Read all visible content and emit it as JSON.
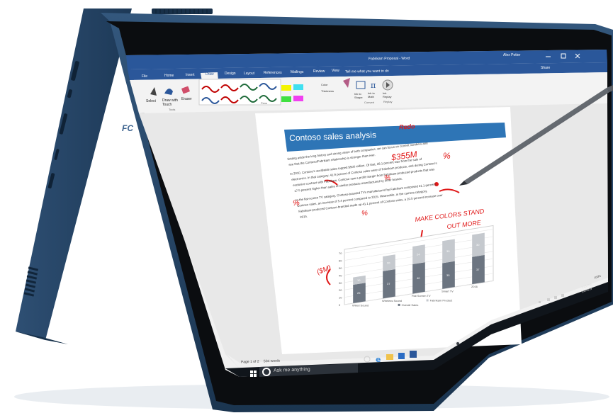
{
  "window": {
    "title": "Fabrikam Proposal - Word",
    "user": "Alex Potter"
  },
  "ribbon": {
    "tabs": [
      "File",
      "Home",
      "Insert",
      "Draw",
      "Design",
      "Layout",
      "References",
      "Mailings",
      "Review",
      "View"
    ],
    "active_tab": "Draw",
    "tell_me": "Tell me what you want to do",
    "share": "Share",
    "tools": {
      "select": "Select",
      "draw_with_touch": "Draw with Touch",
      "eraser": "Eraser",
      "group_label": "Tools"
    },
    "pens_group_label": "Pens",
    "color_label": "Color",
    "thickness_label": "Thickness",
    "convert": {
      "ink_to_shape": "Ink to Shape",
      "ink_to_math": "Ink to Math",
      "group_label": "Convert"
    },
    "ink_replay": "Ink Replay",
    "replay_label": "Replay"
  },
  "document": {
    "heading": "Contoso sales analysis",
    "paragraphs": [
      "Setting aside the long history and strong vision of both companies, we can focus on current numbers and",
      "see that the Contoso/Fabrikam relationship is stronger than ever.",
      "In 2010, Contoso's worldwide sales topped $500 million. Of that, 28.1 percent was from the sale of",
      "electronics. In that category, 41.9 percent of Contoso sales were of Fabrikam products, and during Contoso's",
      "exclusive contract with Fabrikam, Contoso saw a profit margin from Fabrikam-produced products that was",
      "17.5 percent higher than sales of similar products manufactured by other brands.",
      "In the flat-screen TV category, Contoso-branded TVs manufactured by Fabrikam comprised 41.1 percent",
      "Contoso sales, an increase of 5.4 percent compared to 2015. Meanwhile, in the camera category,",
      "Fabrikam-produced Contoso-branded made up 41.1 percent of Contoso sales, a 10.5 percent increase over",
      "2015."
    ]
  },
  "ink": {
    "heading_note": "Redo",
    "amount_note": "$355M",
    "percent_note": "%",
    "chart_note_line1": "MAKE COLORS STAND",
    "chart_note_line2": "OUT MORE",
    "axis_note": "($M)"
  },
  "chart_data": {
    "type": "bar",
    "stacked": true,
    "categories": [
      "Wired Sound",
      "Wireless Sound",
      "Flat Screen TV",
      "Smart TV",
      "2016"
    ],
    "series": [
      {
        "name": "Overall Sales",
        "values": [
          25,
          37,
          40,
          35,
          37
        ]
      },
      {
        "name": "Fabrikam Product",
        "values": [
          10,
          20,
          24,
          30,
          30
        ]
      }
    ],
    "ylim": [
      0,
      75
    ],
    "yticks": [
      "0",
      "10",
      "20",
      "30",
      "40",
      "50",
      "60",
      "70"
    ],
    "colors": {
      "Overall Sales": "#6c7581",
      "Fabrikam Product": "#c5c9ce"
    }
  },
  "statusbar": {
    "page": "Page 1 of 2",
    "words": "504 words",
    "zoom": "100%"
  },
  "taskbar": {
    "search_placeholder": "Ask me anything",
    "time": "1:15 PM",
    "date": "3/2/2019"
  },
  "device": {
    "laptop_color": "#22405f",
    "brand_mark": "FC"
  }
}
